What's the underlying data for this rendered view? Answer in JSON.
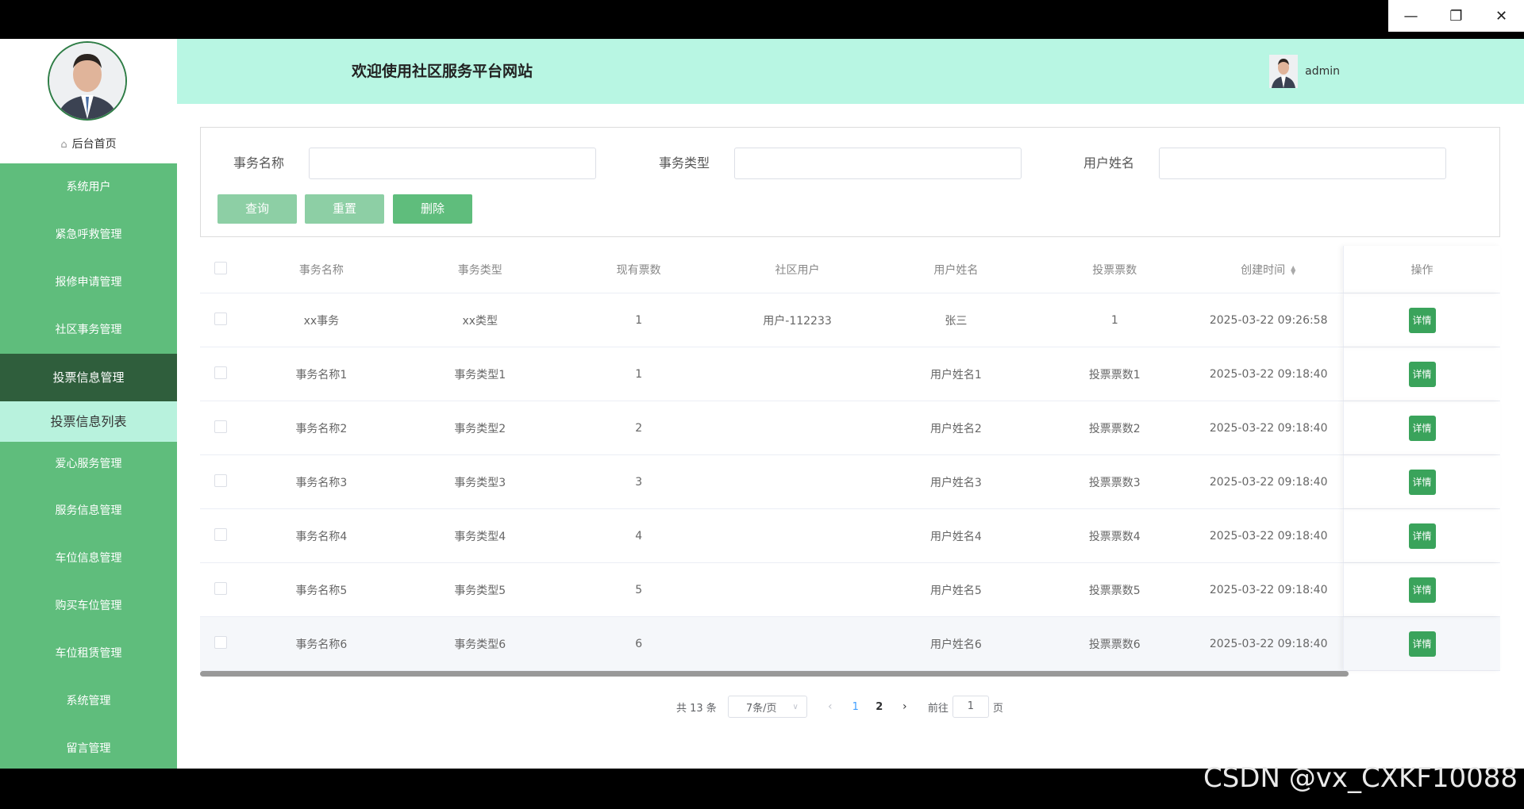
{
  "window_controls": {
    "minimize": "—",
    "restore": "❐",
    "close": "✕"
  },
  "sidebar": {
    "home_icon": "home-icon",
    "home_label": "后台首页",
    "items": [
      {
        "label": "系统用户"
      },
      {
        "label": "紧急呼救管理"
      },
      {
        "label": "报修申请管理"
      },
      {
        "label": "社区事务管理"
      },
      {
        "label": "投票信息管理"
      },
      {
        "label": "爱心服务管理"
      },
      {
        "label": "服务信息管理"
      },
      {
        "label": "车位信息管理"
      },
      {
        "label": "购买车位管理"
      },
      {
        "label": "车位租赁管理"
      },
      {
        "label": "系统管理"
      },
      {
        "label": "留言管理"
      }
    ],
    "active_submenu": "投票信息列表"
  },
  "header": {
    "title": "欢迎使用社区服务平台网站",
    "username": "admin"
  },
  "search": {
    "fields": [
      {
        "label": "事务名称",
        "value": ""
      },
      {
        "label": "事务类型",
        "value": ""
      },
      {
        "label": "用户姓名",
        "value": ""
      }
    ],
    "buttons": {
      "query": "查询",
      "reset": "重置",
      "delete": "删除"
    }
  },
  "table": {
    "columns": [
      "事务名称",
      "事务类型",
      "现有票数",
      "社区用户",
      "用户姓名",
      "投票票数",
      "创建时间",
      "操作"
    ],
    "action_label": "详情",
    "rows": [
      [
        "xx事务",
        "xx类型",
        "1",
        "用户-112233",
        "张三",
        "1",
        "2025-03-22 09:26:58"
      ],
      [
        "事务名称1",
        "事务类型1",
        "1",
        "",
        "用户姓名1",
        "投票票数1",
        "2025-03-22 09:18:40"
      ],
      [
        "事务名称2",
        "事务类型2",
        "2",
        "",
        "用户姓名2",
        "投票票数2",
        "2025-03-22 09:18:40"
      ],
      [
        "事务名称3",
        "事务类型3",
        "3",
        "",
        "用户姓名3",
        "投票票数3",
        "2025-03-22 09:18:40"
      ],
      [
        "事务名称4",
        "事务类型4",
        "4",
        "",
        "用户姓名4",
        "投票票数4",
        "2025-03-22 09:18:40"
      ],
      [
        "事务名称5",
        "事务类型5",
        "5",
        "",
        "用户姓名5",
        "投票票数5",
        "2025-03-22 09:18:40"
      ],
      [
        "事务名称6",
        "事务类型6",
        "6",
        "",
        "用户姓名6",
        "投票票数6",
        "2025-03-22 09:18:40"
      ]
    ]
  },
  "pagination": {
    "total_text": "共 13 条",
    "page_size": "7条/页",
    "pages": [
      "1",
      "2"
    ],
    "current": "1",
    "goto_prefix": "前往",
    "goto_value": "1",
    "goto_suffix": "页"
  },
  "watermark": "CSDN @vx_CXKF10088"
}
